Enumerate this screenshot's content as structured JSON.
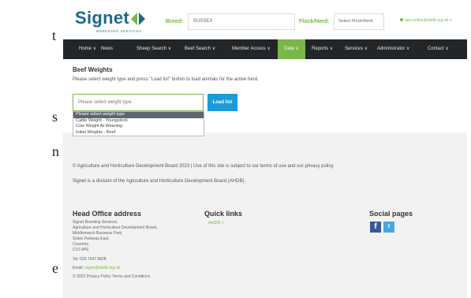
{
  "left_edge_fragments": [
    "t",
    "s",
    "n",
    "e"
  ],
  "header": {
    "logo_text": "Signet",
    "logo_sub": "BREEDING SERVICES",
    "breed_label": "Breed:",
    "breed_value": "SUSSEX",
    "flock_label": "Flock/Herd:",
    "flock_value": "Select Flock/Herd",
    "user_email": "lavs.online@ahdb.org.uk ∨"
  },
  "nav": {
    "items": [
      {
        "label": "Home ∨"
      },
      {
        "label": "News"
      },
      {
        "label": "Sheep Search ∨"
      },
      {
        "label": "Beef Search ∨"
      },
      {
        "label": "Member Access ∨"
      },
      {
        "label": "Data ∨"
      },
      {
        "label": "Reports ∨"
      },
      {
        "label": "Services ∨"
      },
      {
        "label": "Administrator ∨"
      },
      {
        "label": "Contact ∨"
      }
    ],
    "active": "Data"
  },
  "content": {
    "title": "Beef Weights",
    "instructions": "Please select weight type and press \"Load list\" button to load animals for the active herd.",
    "select_placeholder": "Please select weight type",
    "load_button": "Load list",
    "dropdown_options": [
      "Please select weight type",
      "Cattle Weight - Youngstock",
      "Cow Weight At Weaning",
      "Initial Weights - Beef"
    ]
  },
  "footer": {
    "copyright": "© Agriculture and Horticulture Development Board 2023 | Use of this site is subject to our terms of use and our privacy policy.",
    "division": "Signet is a division of the Agriculture and Horticulture Development Board (AHDB).",
    "head_office_title": "Head Office address",
    "address_lines": [
      "Signet Breeding Services,",
      "Agriculture and Horticulture Development Board,",
      "Middlemarch Business Park,",
      "Siskin Parkway East,",
      "Coventry,",
      "CV3 4PE"
    ],
    "tel": "Tel: 024 7647 8828",
    "email_prefix": "Email: ",
    "email": "signet@ahdb.org.uk",
    "bottom_line": "© 2023 Privacy Policy Terms and Conditions",
    "quick_links_title": "Quick links",
    "quick_link": "AHDB »",
    "social_title": "Social pages",
    "social": [
      {
        "name": "facebook",
        "glyph": "f"
      },
      {
        "name": "twitter",
        "glyph": "t"
      }
    ]
  },
  "colors": {
    "brand_blue": "#1b6a8c",
    "brand_green": "#7ab648",
    "nav_bg": "#222629",
    "button_blue": "#1b9bd7",
    "footer_bg": "#f2f2f2"
  }
}
